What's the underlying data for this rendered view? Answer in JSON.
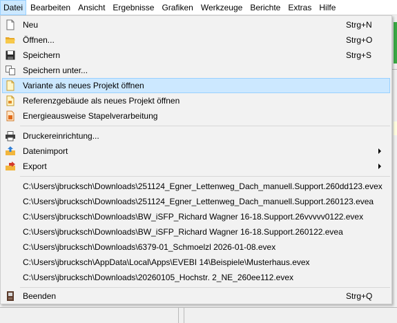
{
  "menubar": {
    "items": [
      {
        "label": "Datei"
      },
      {
        "label": "Bearbeiten"
      },
      {
        "label": "Ansicht"
      },
      {
        "label": "Ergebnisse"
      },
      {
        "label": "Grafiken"
      },
      {
        "label": "Werkzeuge"
      },
      {
        "label": "Berichte"
      },
      {
        "label": "Extras"
      },
      {
        "label": "Hilfe"
      }
    ]
  },
  "file_menu": {
    "new": {
      "label": "Neu",
      "shortcut": "Strg+N",
      "icon": "new-file-icon"
    },
    "open": {
      "label": "Öffnen...",
      "shortcut": "Strg+O",
      "icon": "folder-icon"
    },
    "save": {
      "label": "Speichern",
      "shortcut": "Strg+S",
      "icon": "floppy-disk-icon"
    },
    "save_as": {
      "label": "Speichern unter...",
      "icon": "copy-pages-icon"
    },
    "variant": {
      "label": "Variante als neues Projekt öffnen",
      "icon": "variant-document-icon"
    },
    "reference": {
      "label": "Referenzgebäude als neues Projekt öffnen",
      "icon": "reference-document-icon"
    },
    "batch": {
      "label": "Energieausweise Stapelverarbeitung",
      "icon": "batch-document-icon"
    },
    "printer": {
      "label": "Druckereinrichtung...",
      "icon": "printer-icon"
    },
    "import": {
      "label": "Datenimport",
      "icon": "import-icon"
    },
    "export": {
      "label": "Export",
      "icon": "export-icon"
    },
    "recent": [
      "C:\\Users\\jbrucksch\\Downloads\\251124_Egner_Lettenweg_Dach_manuell.Support.260dd123.evex",
      "C:\\Users\\jbrucksch\\Downloads\\251124_Egner_Lettenweg_Dach_manuell.Support.260123.evea",
      "C:\\Users\\jbrucksch\\Downloads\\BW_iSFP_Richard Wagner 16-18.Support.26vvvvv0122.evex",
      "C:\\Users\\jbrucksch\\Downloads\\BW_iSFP_Richard Wagner 16-18.Support.260122.evea",
      "C:\\Users\\jbrucksch\\Downloads\\6379-01_Schmoelzl 2026-01-08.evex",
      "C:\\Users\\jbrucksch\\AppData\\Local\\Apps\\EVEBI 14\\Beispiele\\Musterhaus.evex",
      "C:\\Users\\jbrucksch\\Downloads\\20260105_Hochstr. 2_NE_260ee112.evex"
    ],
    "exit": {
      "label": "Beenden",
      "shortcut": "Strg+Q",
      "icon": "exit-door-icon"
    }
  },
  "colors": {
    "highlight": "#cce8ff",
    "highlight_border": "#99d1ff",
    "menu_background": "#f2f2f2"
  }
}
